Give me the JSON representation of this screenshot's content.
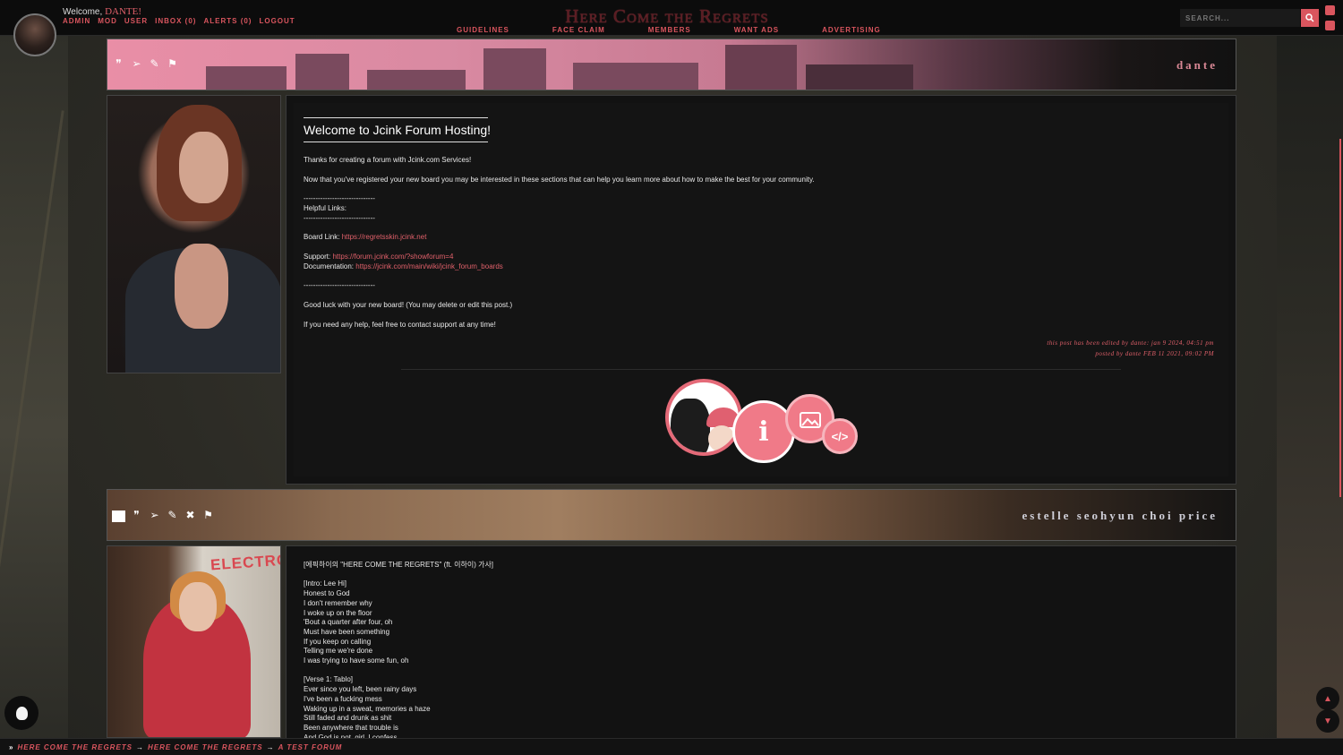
{
  "header": {
    "welcome_text": "Welcome,",
    "username": "DANTE!",
    "user_links": [
      "ADMIN",
      "MOD",
      "USER",
      "INBOX (0)",
      "ALERTS (0)",
      "LOGOUT"
    ],
    "site_title": "Here Come the Regrets",
    "nav": [
      "GUIDELINES",
      "FACE CLAIM",
      "MEMBERS",
      "WANT ADS",
      "ADVERTISING"
    ],
    "search_placeholder": "SEARCH..."
  },
  "post1": {
    "author": "dante",
    "title": "Welcome to Jcink Forum Hosting!",
    "intro": "Thanks for creating a forum with Jcink.com Services!",
    "intro2": "Now that you've registered your new board you may be interested in these sections that can help you learn more about how to make the best for your community.",
    "rule_short": "------------------------------",
    "helpful_links_label": "Helpful Links:",
    "board_link_label": "Board Link:",
    "board_link": "https://regretsskin.jcink.net",
    "support_label": "Support:",
    "support_link": "https://forum.jcink.com/?showforum=4",
    "docs_label": "Documentation:",
    "docs_link": "https://jcink.com/main/wiki/jcink_forum_boards",
    "goodluck": "Good luck with your new board! (You may delete or edit this post.)",
    "help": "If you need any help, feel free to contact support at any time!",
    "edited": "this post has been edited by dante: jan 9 2024, 04:51 pm",
    "posted": "posted by dante FEB 11 2021, 09:02 PM"
  },
  "post2": {
    "author": "estelle seohyun choi price",
    "sign_text": "ELECTRON",
    "lyrics": "[에픽하이의 \"HERE COME THE REGRETS\" (ft. 이하이) 가사]\n\n[Intro: Lee Hi]\nHonest to God\nI don't remember why\nI woke up on the floor\n'Bout a quarter after four, oh\nMust have been something\nIf you keep on calling\nTelling me we're done\nI was trying to have some fun, oh\n\n[Verse 1: Tablo]\nEver since you left, been rainy days\nI've been a fucking mess\nWaking up in a sweat, memories a haze\nStill faded and drunk as shit\nBeen anywhere that trouble is\nAnd God is not, girl, I confess"
  },
  "breadcrumb": [
    "HERE COME THE REGRETS",
    "HERE COME THE REGRETS",
    "A TEST FORUM"
  ],
  "colors": {
    "accent": "#d9555e",
    "background": "#121212"
  },
  "icons": [
    "quote-icon",
    "send-icon",
    "edit-icon",
    "flag-icon",
    "search-icon",
    "lightbulb-icon",
    "arrow-up-icon",
    "arrow-down-icon"
  ]
}
